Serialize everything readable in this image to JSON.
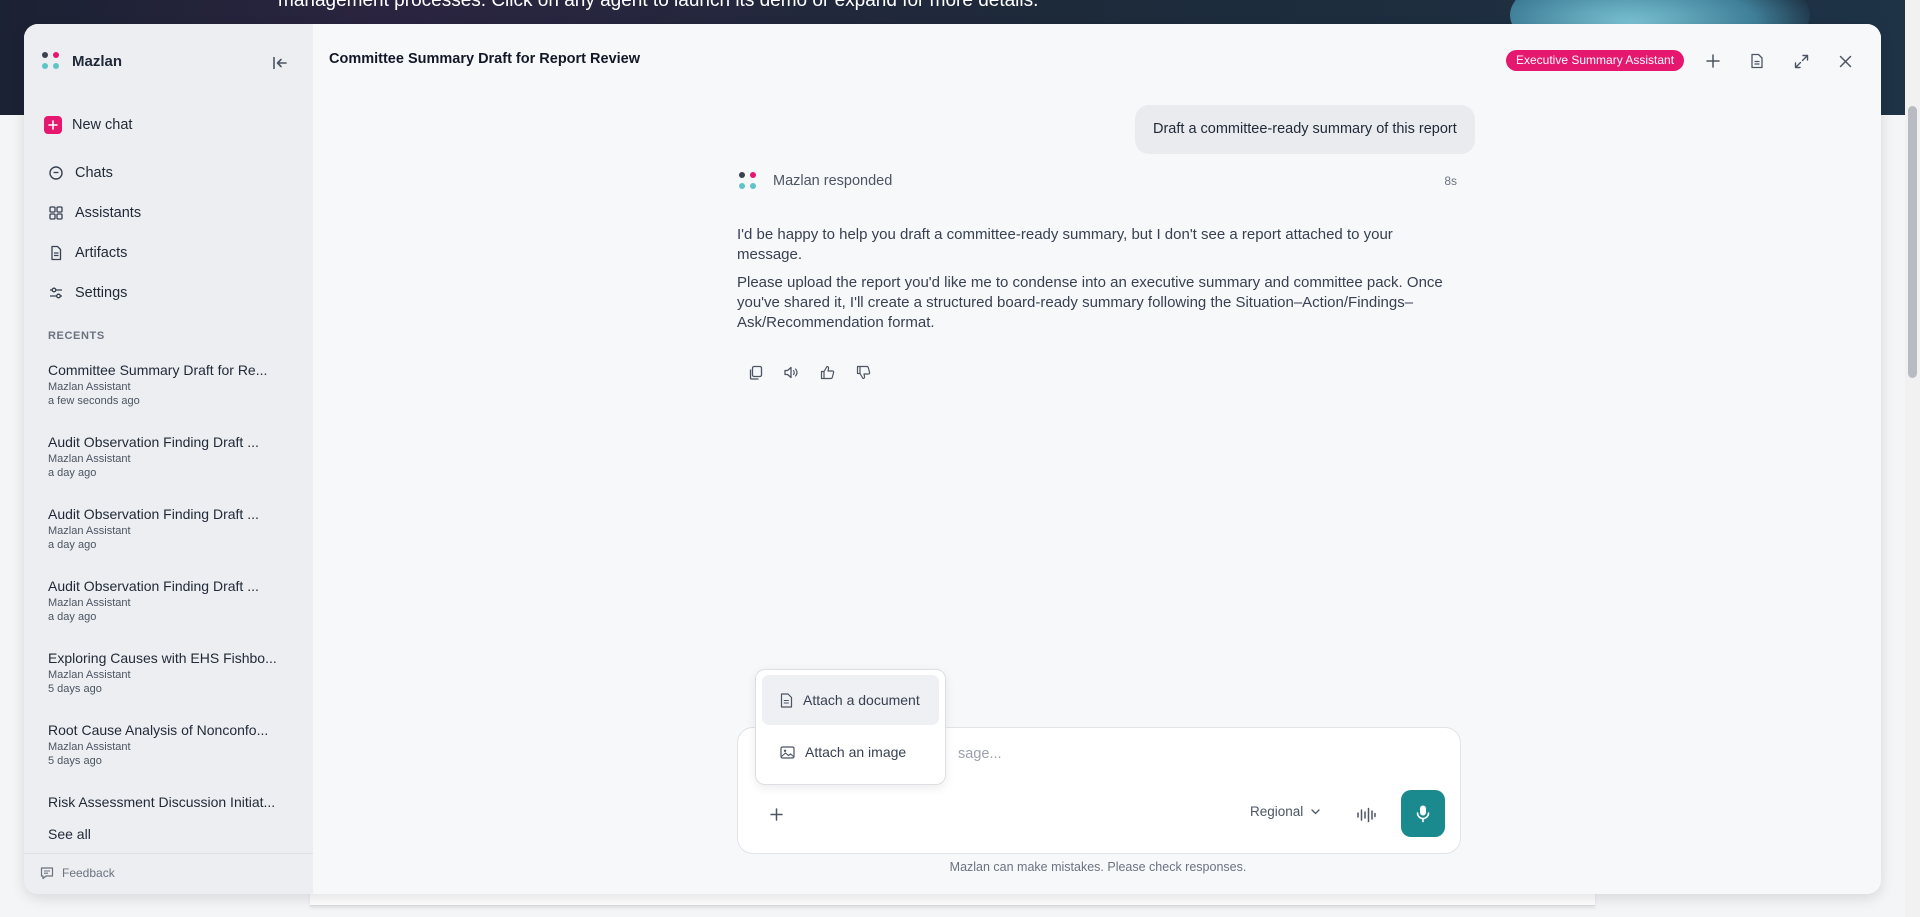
{
  "background": {
    "hero_text": "management processes. Click on any agent to launch its demo or expand for more details."
  },
  "sidebar": {
    "brand": "Mazlan",
    "new_chat": "New chat",
    "nav": [
      {
        "label": "Chats",
        "icon": "chat-icon"
      },
      {
        "label": "Assistants",
        "icon": "grid-icon"
      },
      {
        "label": "Artifacts",
        "icon": "document-icon"
      },
      {
        "label": "Settings",
        "icon": "sliders-icon"
      }
    ],
    "recents_heading": "RECENTS",
    "recents": [
      {
        "title": "Committee Summary Draft for Re...",
        "assistant": "Mazlan Assistant",
        "when": "a few seconds ago"
      },
      {
        "title": "Audit Observation Finding Draft ...",
        "assistant": "Mazlan Assistant",
        "when": "a day ago"
      },
      {
        "title": "Audit Observation Finding Draft ...",
        "assistant": "Mazlan Assistant",
        "when": "a day ago"
      },
      {
        "title": "Audit Observation Finding Draft ...",
        "assistant": "Mazlan Assistant",
        "when": "a day ago"
      },
      {
        "title": "Exploring Causes with EHS Fishbo...",
        "assistant": "Mazlan Assistant",
        "when": "5 days ago"
      },
      {
        "title": "Root Cause Analysis of Nonconfo...",
        "assistant": "Mazlan Assistant",
        "when": "5 days ago"
      },
      {
        "title": "Risk Assessment Discussion Initiat..."
      }
    ],
    "see_all": "See all",
    "feedback": "Feedback"
  },
  "header": {
    "title": "Committee Summary Draft for Report Review",
    "assistant_badge": "Executive Summary Assistant"
  },
  "conversation": {
    "user_message": "Draft a committee-ready summary of this report",
    "responder": "Mazlan responded",
    "response_time": "8s",
    "response_paragraphs": [
      "I'd be happy to help you draft a committee-ready summary, but I don't see a report attached to your message.",
      "Please upload the report you'd like me to condense into an executive summary and committee pack. Once you've shared it, I'll create a structured board-ready summary following the Situation–Action/Findings–Ask/Recommendation format."
    ]
  },
  "composer": {
    "placeholder_visible": "sage...",
    "region": "Regional",
    "disclaimer": "Mazlan can make mistakes. Please check responses."
  },
  "attach_menu": {
    "items": [
      "Attach a document",
      "Attach an image"
    ]
  },
  "colors": {
    "accent_pink": "#e5176e",
    "accent_teal": "#1b8a8f"
  }
}
